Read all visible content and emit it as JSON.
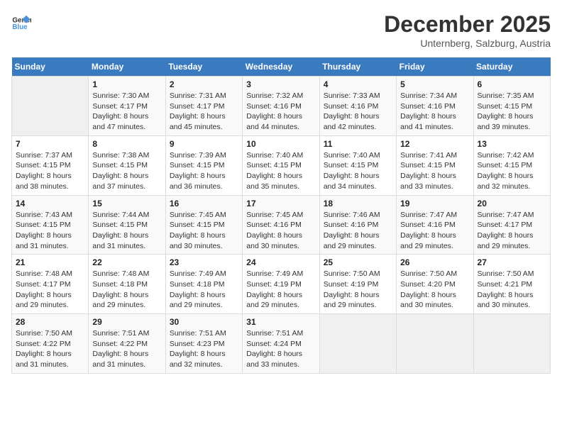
{
  "header": {
    "logo_line1": "General",
    "logo_line2": "Blue",
    "month": "December 2025",
    "location": "Unternberg, Salzburg, Austria"
  },
  "days_of_week": [
    "Sunday",
    "Monday",
    "Tuesday",
    "Wednesday",
    "Thursday",
    "Friday",
    "Saturday"
  ],
  "weeks": [
    [
      {
        "day": "",
        "sunrise": "",
        "sunset": "",
        "daylight": ""
      },
      {
        "day": "1",
        "sunrise": "Sunrise: 7:30 AM",
        "sunset": "Sunset: 4:17 PM",
        "daylight": "Daylight: 8 hours and 47 minutes."
      },
      {
        "day": "2",
        "sunrise": "Sunrise: 7:31 AM",
        "sunset": "Sunset: 4:17 PM",
        "daylight": "Daylight: 8 hours and 45 minutes."
      },
      {
        "day": "3",
        "sunrise": "Sunrise: 7:32 AM",
        "sunset": "Sunset: 4:16 PM",
        "daylight": "Daylight: 8 hours and 44 minutes."
      },
      {
        "day": "4",
        "sunrise": "Sunrise: 7:33 AM",
        "sunset": "Sunset: 4:16 PM",
        "daylight": "Daylight: 8 hours and 42 minutes."
      },
      {
        "day": "5",
        "sunrise": "Sunrise: 7:34 AM",
        "sunset": "Sunset: 4:16 PM",
        "daylight": "Daylight: 8 hours and 41 minutes."
      },
      {
        "day": "6",
        "sunrise": "Sunrise: 7:35 AM",
        "sunset": "Sunset: 4:15 PM",
        "daylight": "Daylight: 8 hours and 39 minutes."
      }
    ],
    [
      {
        "day": "7",
        "sunrise": "Sunrise: 7:37 AM",
        "sunset": "Sunset: 4:15 PM",
        "daylight": "Daylight: 8 hours and 38 minutes."
      },
      {
        "day": "8",
        "sunrise": "Sunrise: 7:38 AM",
        "sunset": "Sunset: 4:15 PM",
        "daylight": "Daylight: 8 hours and 37 minutes."
      },
      {
        "day": "9",
        "sunrise": "Sunrise: 7:39 AM",
        "sunset": "Sunset: 4:15 PM",
        "daylight": "Daylight: 8 hours and 36 minutes."
      },
      {
        "day": "10",
        "sunrise": "Sunrise: 7:40 AM",
        "sunset": "Sunset: 4:15 PM",
        "daylight": "Daylight: 8 hours and 35 minutes."
      },
      {
        "day": "11",
        "sunrise": "Sunrise: 7:40 AM",
        "sunset": "Sunset: 4:15 PM",
        "daylight": "Daylight: 8 hours and 34 minutes."
      },
      {
        "day": "12",
        "sunrise": "Sunrise: 7:41 AM",
        "sunset": "Sunset: 4:15 PM",
        "daylight": "Daylight: 8 hours and 33 minutes."
      },
      {
        "day": "13",
        "sunrise": "Sunrise: 7:42 AM",
        "sunset": "Sunset: 4:15 PM",
        "daylight": "Daylight: 8 hours and 32 minutes."
      }
    ],
    [
      {
        "day": "14",
        "sunrise": "Sunrise: 7:43 AM",
        "sunset": "Sunset: 4:15 PM",
        "daylight": "Daylight: 8 hours and 31 minutes."
      },
      {
        "day": "15",
        "sunrise": "Sunrise: 7:44 AM",
        "sunset": "Sunset: 4:15 PM",
        "daylight": "Daylight: 8 hours and 31 minutes."
      },
      {
        "day": "16",
        "sunrise": "Sunrise: 7:45 AM",
        "sunset": "Sunset: 4:15 PM",
        "daylight": "Daylight: 8 hours and 30 minutes."
      },
      {
        "day": "17",
        "sunrise": "Sunrise: 7:45 AM",
        "sunset": "Sunset: 4:16 PM",
        "daylight": "Daylight: 8 hours and 30 minutes."
      },
      {
        "day": "18",
        "sunrise": "Sunrise: 7:46 AM",
        "sunset": "Sunset: 4:16 PM",
        "daylight": "Daylight: 8 hours and 29 minutes."
      },
      {
        "day": "19",
        "sunrise": "Sunrise: 7:47 AM",
        "sunset": "Sunset: 4:16 PM",
        "daylight": "Daylight: 8 hours and 29 minutes."
      },
      {
        "day": "20",
        "sunrise": "Sunrise: 7:47 AM",
        "sunset": "Sunset: 4:17 PM",
        "daylight": "Daylight: 8 hours and 29 minutes."
      }
    ],
    [
      {
        "day": "21",
        "sunrise": "Sunrise: 7:48 AM",
        "sunset": "Sunset: 4:17 PM",
        "daylight": "Daylight: 8 hours and 29 minutes."
      },
      {
        "day": "22",
        "sunrise": "Sunrise: 7:48 AM",
        "sunset": "Sunset: 4:18 PM",
        "daylight": "Daylight: 8 hours and 29 minutes."
      },
      {
        "day": "23",
        "sunrise": "Sunrise: 7:49 AM",
        "sunset": "Sunset: 4:18 PM",
        "daylight": "Daylight: 8 hours and 29 minutes."
      },
      {
        "day": "24",
        "sunrise": "Sunrise: 7:49 AM",
        "sunset": "Sunset: 4:19 PM",
        "daylight": "Daylight: 8 hours and 29 minutes."
      },
      {
        "day": "25",
        "sunrise": "Sunrise: 7:50 AM",
        "sunset": "Sunset: 4:19 PM",
        "daylight": "Daylight: 8 hours and 29 minutes."
      },
      {
        "day": "26",
        "sunrise": "Sunrise: 7:50 AM",
        "sunset": "Sunset: 4:20 PM",
        "daylight": "Daylight: 8 hours and 30 minutes."
      },
      {
        "day": "27",
        "sunrise": "Sunrise: 7:50 AM",
        "sunset": "Sunset: 4:21 PM",
        "daylight": "Daylight: 8 hours and 30 minutes."
      }
    ],
    [
      {
        "day": "28",
        "sunrise": "Sunrise: 7:50 AM",
        "sunset": "Sunset: 4:22 PM",
        "daylight": "Daylight: 8 hours and 31 minutes."
      },
      {
        "day": "29",
        "sunrise": "Sunrise: 7:51 AM",
        "sunset": "Sunset: 4:22 PM",
        "daylight": "Daylight: 8 hours and 31 minutes."
      },
      {
        "day": "30",
        "sunrise": "Sunrise: 7:51 AM",
        "sunset": "Sunset: 4:23 PM",
        "daylight": "Daylight: 8 hours and 32 minutes."
      },
      {
        "day": "31",
        "sunrise": "Sunrise: 7:51 AM",
        "sunset": "Sunset: 4:24 PM",
        "daylight": "Daylight: 8 hours and 33 minutes."
      },
      {
        "day": "",
        "sunrise": "",
        "sunset": "",
        "daylight": ""
      },
      {
        "day": "",
        "sunrise": "",
        "sunset": "",
        "daylight": ""
      },
      {
        "day": "",
        "sunrise": "",
        "sunset": "",
        "daylight": ""
      }
    ]
  ]
}
